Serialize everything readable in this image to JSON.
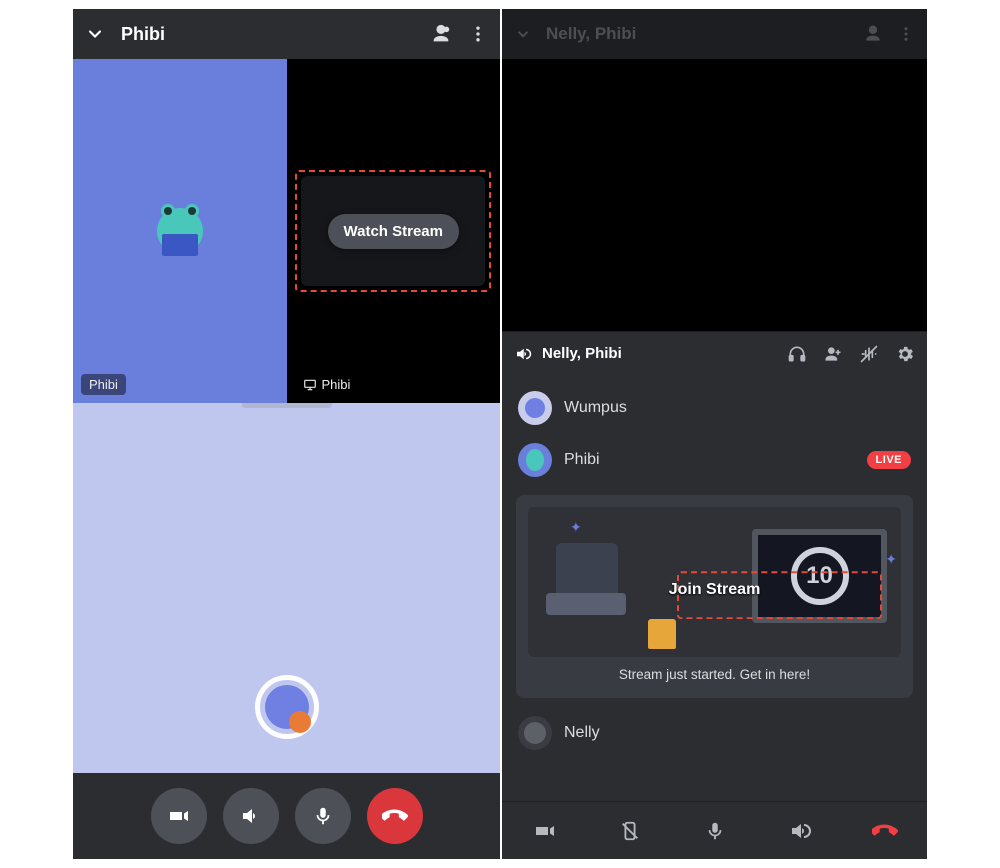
{
  "left": {
    "header": {
      "title": "Phibi"
    },
    "tiles": {
      "userName": "Phibi",
      "streamName": "Phibi",
      "watchStreamLabel": "Watch Stream"
    }
  },
  "right": {
    "topHeader": {
      "title": "Nelly, Phibi"
    },
    "voice": {
      "channelTitle": "Nelly, Phibi",
      "members": {
        "wumpus": "Wumpus",
        "phibi": "Phibi",
        "nelly": "Nelly"
      },
      "liveBadge": "LIVE",
      "tvNumber": "10",
      "joinStreamLabel": "Join Stream",
      "streamMessage": "Stream just started. Get in here!"
    }
  },
  "colors": {
    "red": "#da373c",
    "liveRed": "#f23f43",
    "blurple": "#5865f2"
  }
}
